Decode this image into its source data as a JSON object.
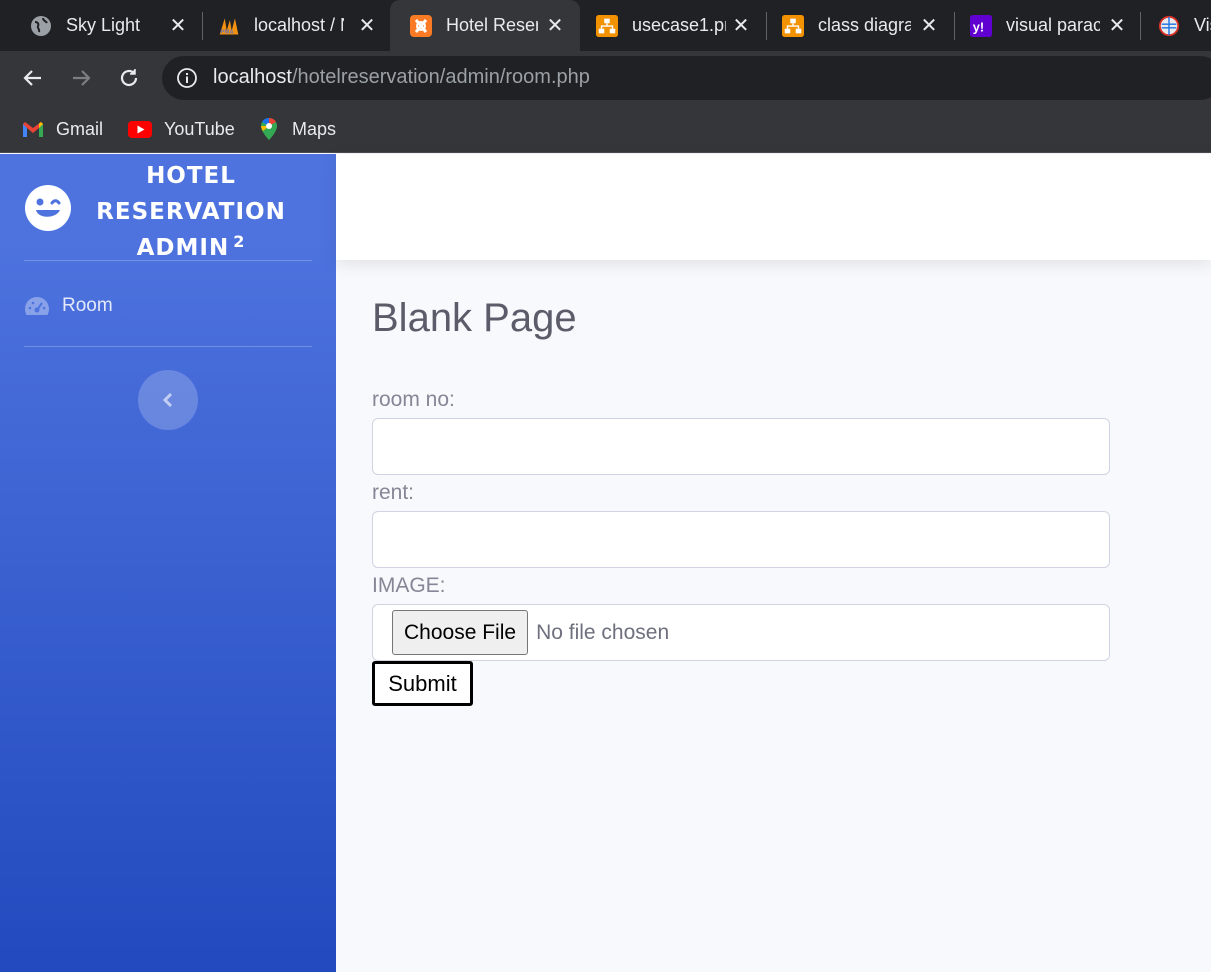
{
  "browser": {
    "tabs": [
      {
        "title": "Sky Light",
        "icon": "globe-icon"
      },
      {
        "title": "localhost / N",
        "icon": "phpmyadmin-icon"
      },
      {
        "title": "Hotel Reser",
        "icon": "xampp-icon"
      },
      {
        "title": "usecase1.pr",
        "icon": "visual-paradigm-icon"
      },
      {
        "title": "class diagra",
        "icon": "visual-paradigm-icon"
      },
      {
        "title": "visual parac",
        "icon": "yahoo-icon"
      },
      {
        "title": "Vis",
        "icon": "globe-color-icon"
      }
    ],
    "active_tab_index": 2,
    "url_host": "localhost",
    "url_path": "/hotelreservation/admin/room.php",
    "bookmarks": [
      {
        "label": "Gmail",
        "icon": "gmail-icon"
      },
      {
        "label": "YouTube",
        "icon": "youtube-icon"
      },
      {
        "label": "Maps",
        "icon": "maps-icon"
      }
    ]
  },
  "sidebar": {
    "brand_lines": [
      "HOTEL",
      "RESERVATION",
      "ADMIN"
    ],
    "brand_sup": "2",
    "brand_icon": "laugh-wink-icon",
    "nav_items": [
      {
        "label": "Room",
        "icon": "tachometer-icon"
      }
    ],
    "toggle_icon": "chevron-left-icon",
    "accent_color": "#4e73df"
  },
  "main": {
    "title": "Blank Page",
    "form": {
      "room_no_label": "room no:",
      "room_no_value": "",
      "rent_label": "rent:",
      "rent_value": "",
      "image_label": "IMAGE:",
      "file_button": "Choose File",
      "file_status": "No file chosen",
      "submit_label": "Submit"
    }
  }
}
